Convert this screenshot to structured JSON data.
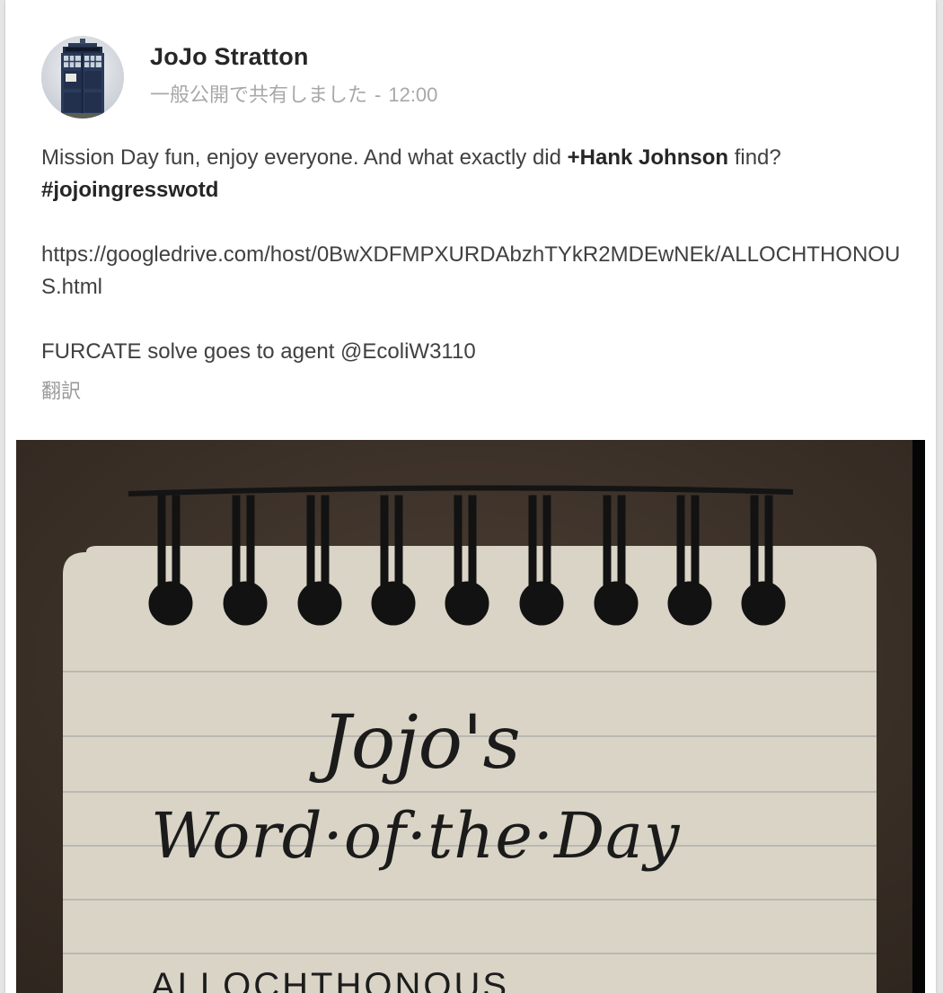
{
  "post": {
    "author_name": "JoJo Stratton",
    "visibility": "一般公開で共有しました",
    "separator": "-",
    "time": "12:00",
    "text_line1_part1": "Mission Day fun, enjoy everyone.  And what exactly did ",
    "mention": "+Hank Johnson",
    "text_line1_part2": " find?",
    "hashtag": "#jojoingresswotd",
    "url": "https://googledrive.com/host/0BwXDFMPXURDAbzhTYkR2MDEwNEk/ALLOCHTHONOUS.html",
    "solve_line": "FURCATE solve goes to agent  @EcoliW3110",
    "translate_label": "翻訳"
  },
  "image": {
    "title_line1": "Jojo's",
    "title_line2": "Word·of·the·Day",
    "word": "ALLOCHTHONOUS"
  }
}
